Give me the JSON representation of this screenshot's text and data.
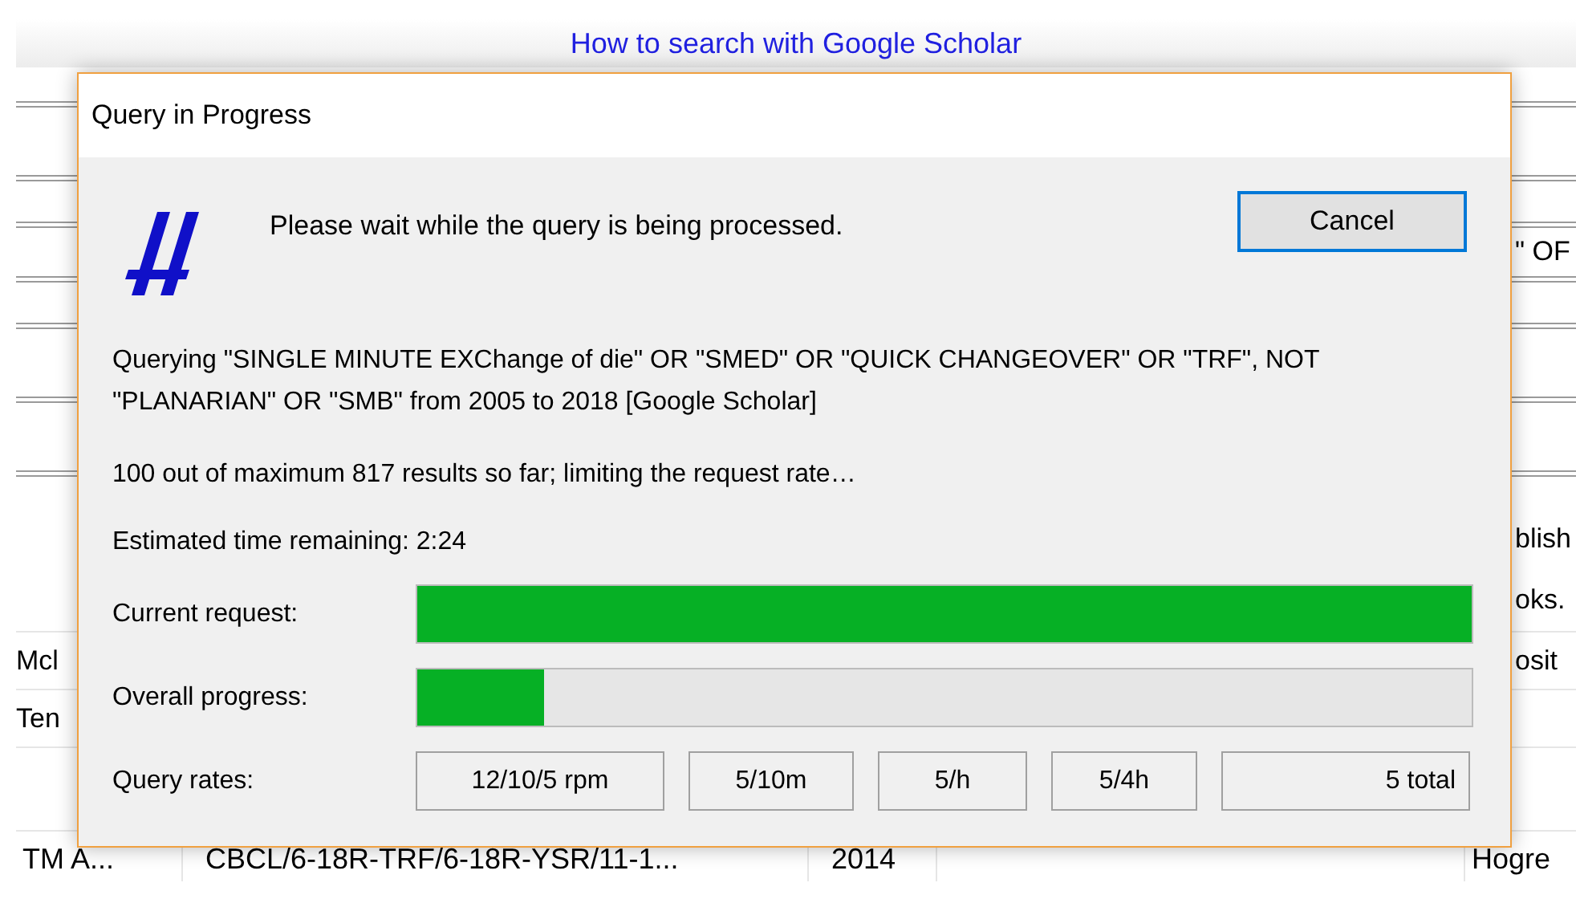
{
  "background": {
    "link": "How to search with Google Scholar",
    "right_fragments": [
      "\" OF",
      "blish",
      "oks.",
      "osit"
    ],
    "left_fragments": [
      "Mcl",
      "Ten"
    ],
    "bottom_row": [
      "TM A...",
      "CBCL/6-18R-TRF/6-18R-YSR/11-1...",
      "2014",
      "Hogre"
    ]
  },
  "dialog": {
    "title": "Query in Progress",
    "message": "Please wait while the query is being processed.",
    "cancel": "Cancel",
    "query": "Querying \"SINGLE MINUTE EXChange of die\" OR \"SMED\" OR \"QUICK CHANGEOVER\" OR \"TRF\", NOT \"PLANARIAN\" OR \"SMB\" from 2005 to 2018 [Google Scholar]",
    "status": "100 out of maximum 817 results so far; limiting the request rate…",
    "eta": "Estimated time remaining: 2:24",
    "progress": [
      {
        "label": "Current request:",
        "level": 1.0
      },
      {
        "label": "Overall progress:",
        "level": 0.12
      }
    ],
    "rates_label": "Query rates:",
    "rates": [
      "12/10/5 rpm",
      "5/10m",
      "5/h",
      "5/4h",
      "5 total"
    ]
  }
}
